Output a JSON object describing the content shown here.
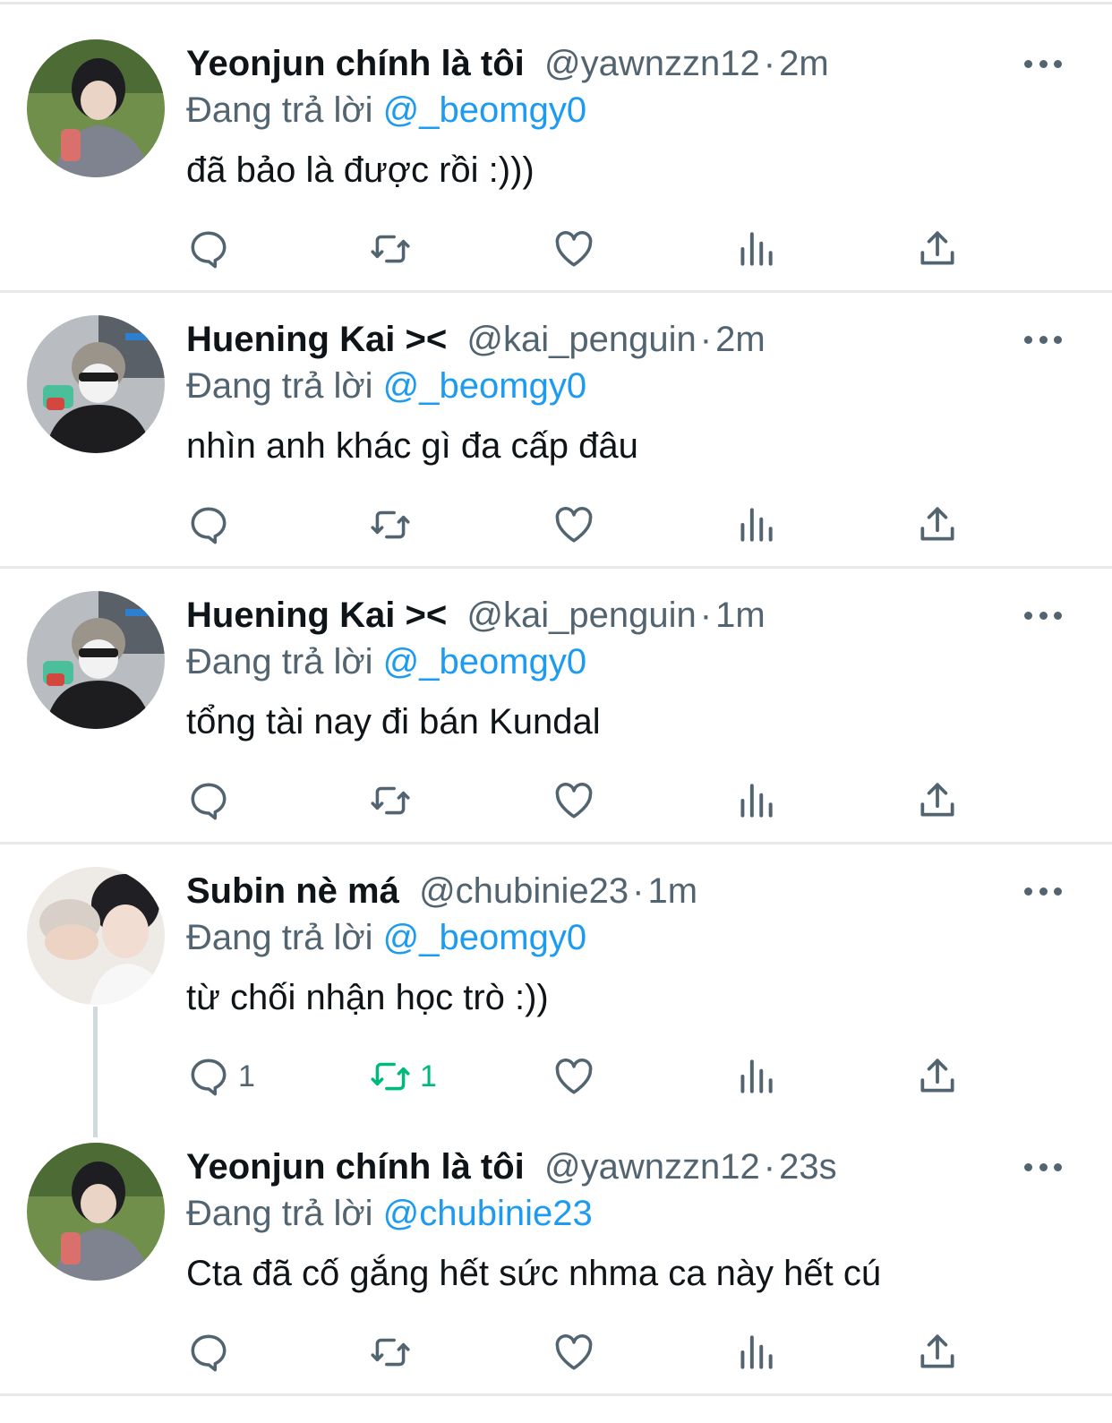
{
  "tweets": [
    {
      "display_name": "Yeonjun chính là tôi",
      "handle": "@yawnzzn12",
      "time": "2m",
      "reply_label": "Đang trả lời",
      "reply_to": "@_beomgy0",
      "text": "đã bảo là được rồi :)))",
      "reply_count": "",
      "retweet_count": ""
    },
    {
      "display_name": "Huening Kai ><",
      "handle": "@kai_penguin",
      "time": "2m",
      "reply_label": "Đang trả lời",
      "reply_to": "@_beomgy0",
      "text": "nhìn anh khác gì đa cấp đâu",
      "reply_count": "",
      "retweet_count": ""
    },
    {
      "display_name": "Huening Kai ><",
      "handle": "@kai_penguin",
      "time": "1m",
      "reply_label": "Đang trả lời",
      "reply_to": "@_beomgy0",
      "text": "tổng tài nay đi bán Kundal",
      "reply_count": "",
      "retweet_count": ""
    },
    {
      "display_name": "Subin nè má",
      "handle": "@chubinie23",
      "time": "1m",
      "reply_label": "Đang trả lời",
      "reply_to": "@_beomgy0",
      "text": "từ chối nhận học trò :))",
      "reply_count": "1",
      "retweet_count": "1"
    },
    {
      "display_name": "Yeonjun chính là tôi",
      "handle": "@yawnzzn12",
      "time": "23s",
      "reply_label": "Đang trả lời",
      "reply_to": "@chubinie23",
      "text": "Cta đã cố gắng hết sức nhma ca này hết cú",
      "reply_count": "",
      "retweet_count": ""
    }
  ],
  "separator": "·",
  "colors": {
    "text_primary": "#0f1419",
    "text_secondary": "#536471",
    "link": "#1d9bf0",
    "retweet_active": "#00ba7c",
    "divider": "#e6e8ea"
  },
  "icons": [
    "reply-icon",
    "retweet-icon",
    "like-icon",
    "views-icon",
    "share-icon",
    "more-icon"
  ]
}
